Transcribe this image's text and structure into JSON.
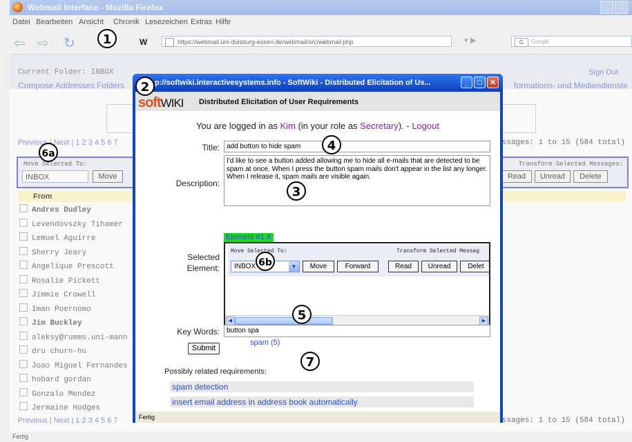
{
  "browser": {
    "window_title": "Webmail Interface - Mozilla Firefox",
    "menu": [
      "Datei",
      "Bearbeiten",
      "Ansicht",
      "Chronik",
      "Lesezeichen",
      "Extras",
      "Hilfe"
    ],
    "url": "https://webmail.uni-duisburg-essen.de/webmail/src/webmail.php",
    "search_placeholder": "Google",
    "status": "Fertig"
  },
  "webmail": {
    "current_folder": "Current Folder: INBOX",
    "sign_out": "Sign Out",
    "nav_links": "Compose  Addresses  Folders",
    "right_link": "formations- und Mediendienste",
    "pager_top": "Previous | Next | 1 2 3 4 5 6 7",
    "pager_bottom": "Previous | Next | 1 2 3 4 5 6 7",
    "count_top": "essages: 1 to 15 (584 total)",
    "count_bottom": "essages: 1 to 15 (584 total)",
    "move_label": "Move Selected To:",
    "transform_label": "Transform Selected Messages:",
    "folder_value": "INBOX",
    "move_button": "Move",
    "read_button": "Read",
    "unread_button": "Unread",
    "delete_button": "Delete",
    "from_header": "From",
    "senders": [
      "Andres Dudley",
      "Levendovszky Tihamér",
      "Lemuel Aguirre",
      "Sherry Jeary",
      "Angelique Prescott",
      "Rosalie Pickett",
      "Jimmie Crowell",
      "Iman Poernomo",
      "Jim Buckley",
      "aleksy@rumms.uni-mann",
      "dru churn-hu",
      "Joao Miguel Fernandes",
      "hobard gordan",
      "Gonzalo Mendez",
      "Jermaine Hodges"
    ]
  },
  "popup": {
    "title": "p://softwiki.interactivesystems.info - SoftWiki - Distributed Elicitation of Us...",
    "logo_soft": "soft",
    "logo_wiki": "WIKI",
    "header": "Distributed Elicitation of User Requirements",
    "login_prefix": "You are logged in as ",
    "user": "Kim",
    "role_prefix": " (in your role as ",
    "role": "Secretary",
    "role_suffix": "). - ",
    "logout": "Logout",
    "title_label": "Title:",
    "title_value": "add button to hide spam",
    "description_label": "Description:",
    "description_value": "I'd like to see a button added allowing me to hide all e-mails that are detected to be spam at once. When I press the button spam mails don't appear in the list any longer. When I release it, spam mails are visible again.",
    "selected_label": "Selected Element:",
    "element_tag": "Element #1",
    "element_close": "X",
    "element": {
      "move_label": "Move Selected To:",
      "transform_label": "Transform Selected Messag",
      "folder_value": "INBOX",
      "move_button": "Move",
      "forward_button": "Forward",
      "read_button": "Read",
      "unread_button": "Unread",
      "delete_button": "Delet"
    },
    "keywords_label": "Key Words:",
    "keywords_value": "button spa",
    "suggestion": "spam (5)",
    "submit_button": "Submit",
    "related_label": "Possibly related requirements:",
    "related": [
      "spam detection",
      "insert email address in address book automatically"
    ],
    "status": "Fertig"
  },
  "callouts": [
    "1",
    "2",
    "3",
    "4",
    "5",
    "6a",
    "6b",
    "7"
  ],
  "colors": {
    "popup_border": "#0b45c2",
    "element_highlight": "#24d424",
    "link_purple": "#7a2a9a",
    "link_blue": "#2a4fd0",
    "logo_orange": "#e4521c"
  }
}
